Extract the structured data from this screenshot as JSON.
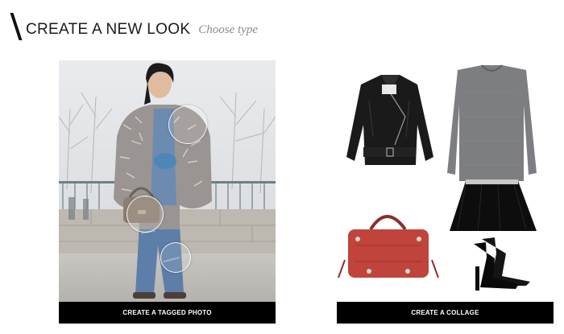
{
  "header": {
    "title": "CREATE A NEW LOOK",
    "subtitle": "Choose type"
  },
  "options": [
    {
      "button_label": "CREATE A TAGGED PHOTO",
      "tag_count": 3
    },
    {
      "button_label": "CREATE A COLLAGE",
      "collage_items": [
        "leather-jacket",
        "grey-sweater",
        "black-skirt",
        "red-handbag",
        "black-sandals"
      ]
    }
  ],
  "colors": {
    "button_bg": "#000000",
    "button_text": "#ffffff",
    "subtitle": "#8a8a8a",
    "bag_red": "#c0443b"
  }
}
